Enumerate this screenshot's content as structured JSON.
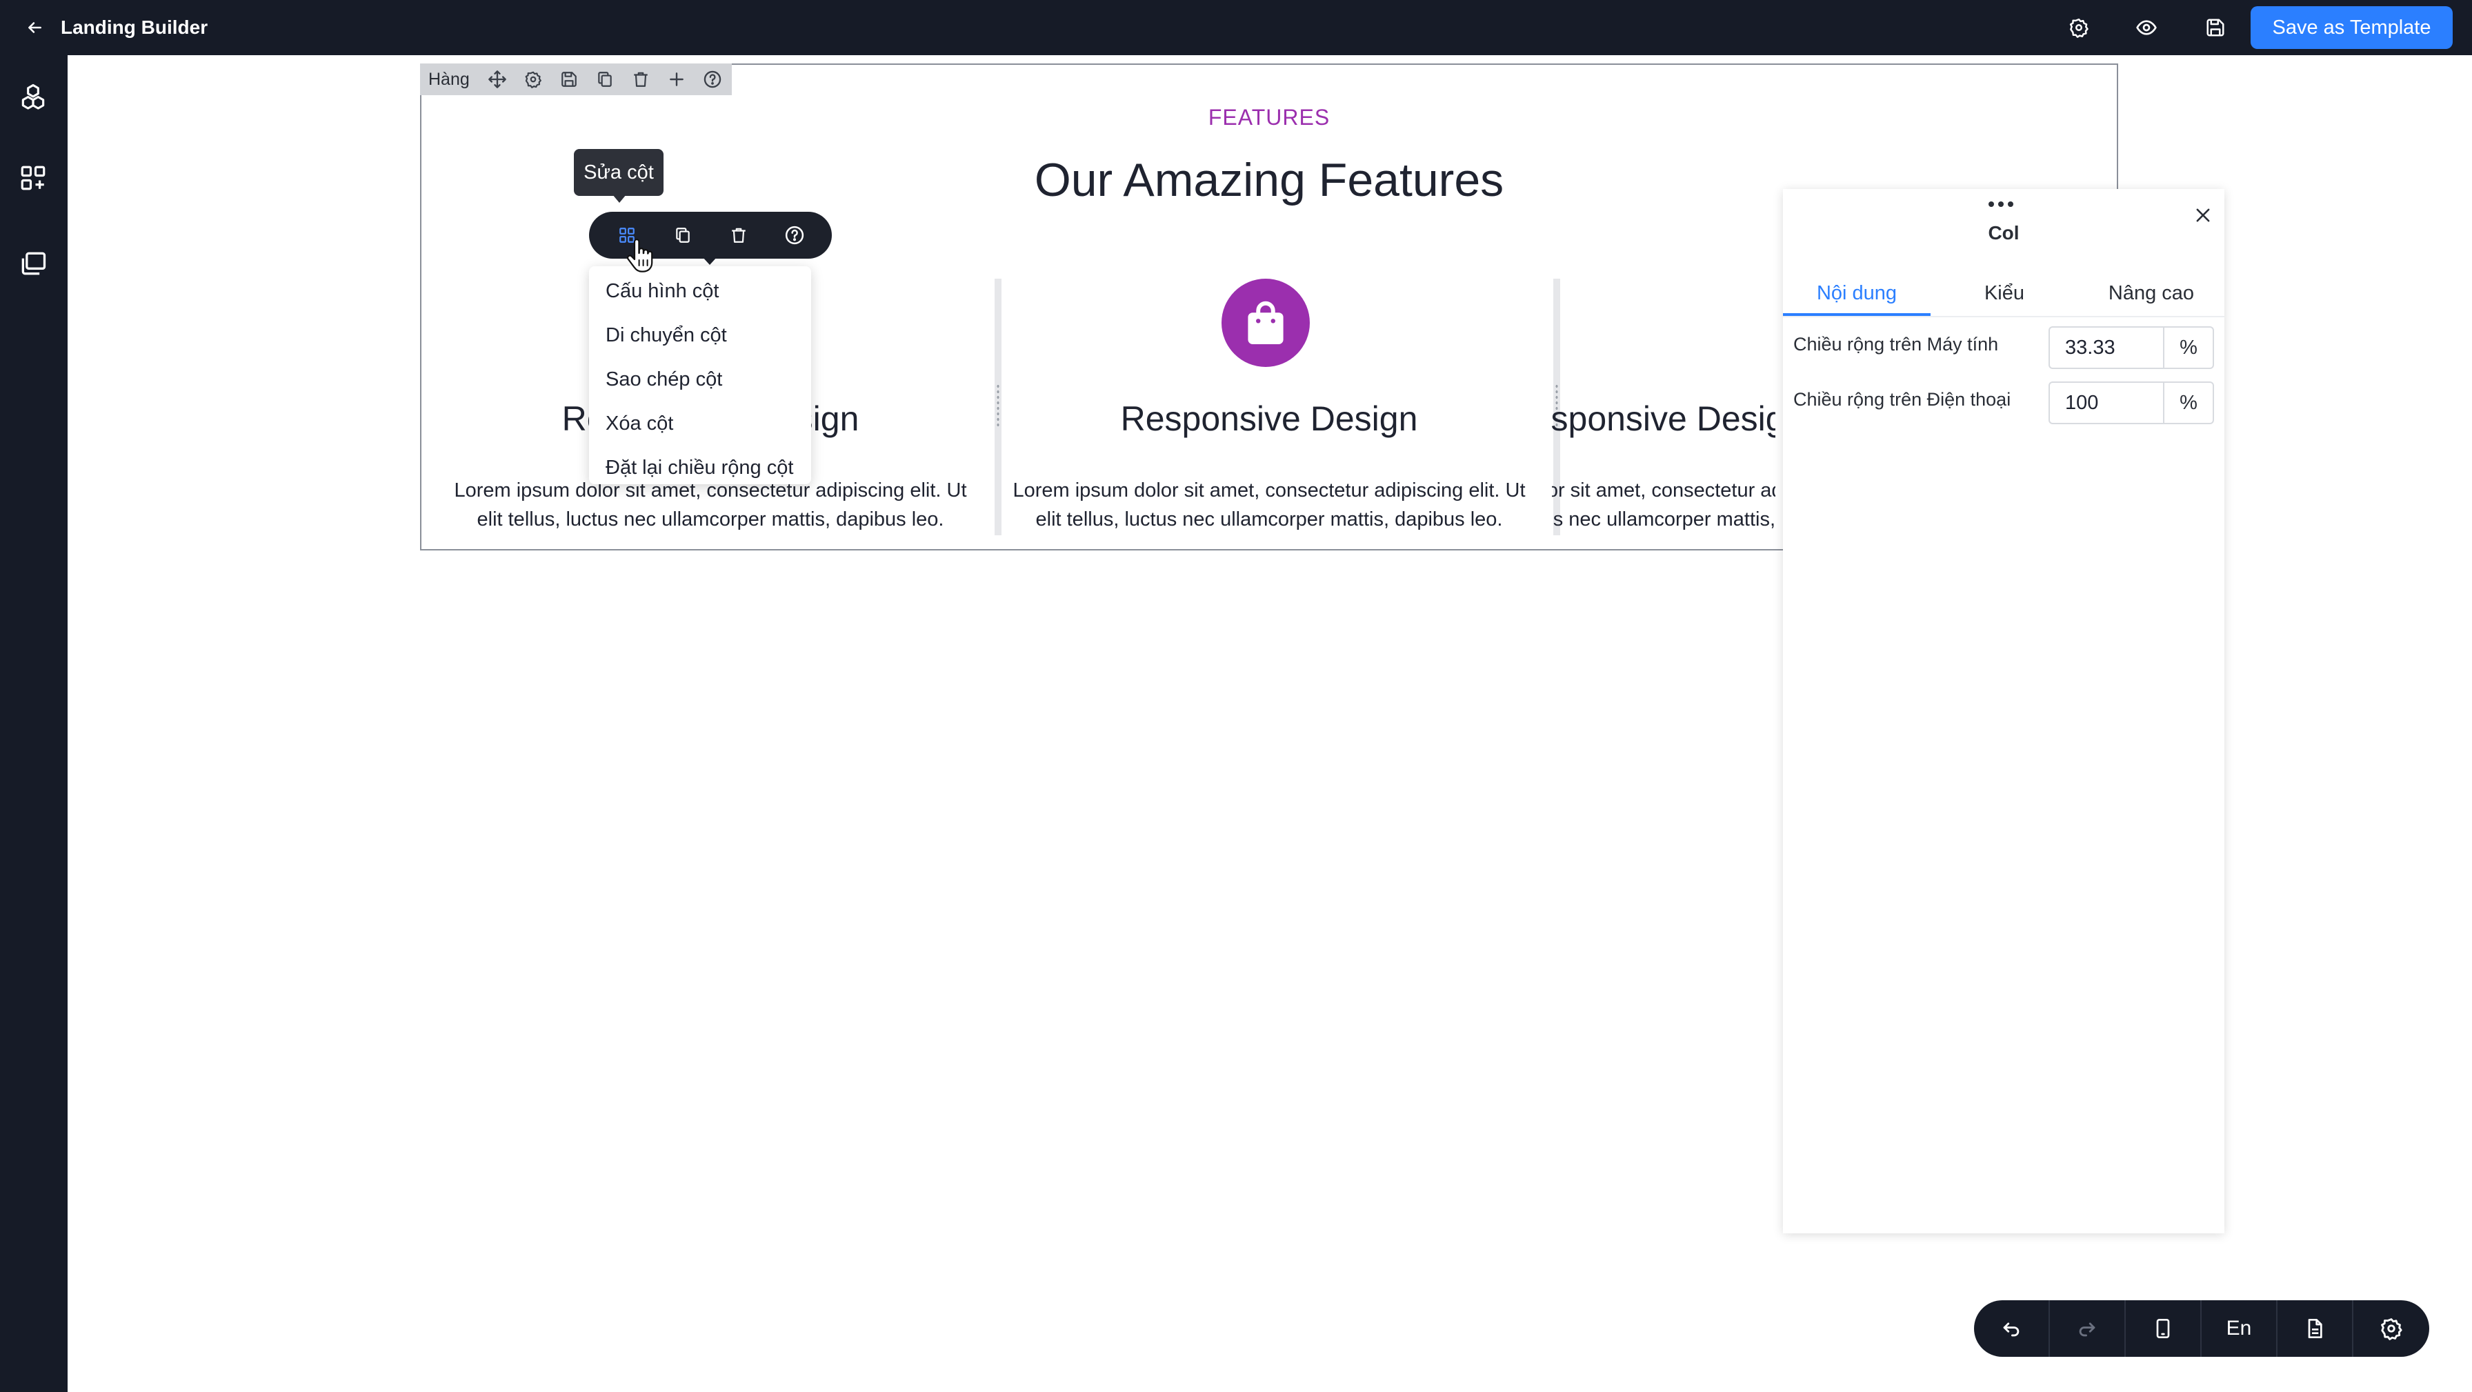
{
  "app": {
    "title": "Landing Builder",
    "save_template_label": "Save as Template"
  },
  "topbar_icons": [
    "settings-icon",
    "eye-icon",
    "save-icon"
  ],
  "sidebar_icons": [
    "cubes-icon",
    "widgets-icon",
    "pages-icon"
  ],
  "row_toolbar": {
    "label": "Hàng",
    "tools": [
      "move-icon",
      "settings-icon",
      "save-icon",
      "copy-icon",
      "trash-icon",
      "plus-icon",
      "help-icon"
    ]
  },
  "section": {
    "tag": "FEATURES",
    "title": "Our Amazing Features",
    "columns": [
      {
        "title": "Responsive Design",
        "text": "Lorem ipsum dolor sit amet, consectetur adipiscing elit. Ut elit tellus, luctus nec ullamcorper mattis, dapibus leo."
      },
      {
        "title": "Responsive Design",
        "text": "Lorem ipsum dolor sit amet, consectetur adipiscing elit. Ut elit tellus, luctus nec ullamcorper mattis, dapibus leo."
      },
      {
        "title": "Responsive Design",
        "text": "Lorem ipsum dolor sit amet, consectetur adipiscing elit. Ut elit tellus, luctus nec ullamcorper mattis, dapibus leo."
      }
    ]
  },
  "column_toolbar": {
    "tooltip": "Sửa cột",
    "tools": [
      "grid-icon",
      "copy-icon",
      "trash-icon",
      "help-icon"
    ]
  },
  "column_menu": [
    "Cấu hình cột",
    "Di chuyển cột",
    "Sao chép cột",
    "Xóa cột",
    "Đặt lại chiều rộng cột"
  ],
  "panel": {
    "title": "Col",
    "tabs": [
      "Nội dung",
      "Kiểu",
      "Nâng cao"
    ],
    "active_tab": "Nội dung",
    "fields": [
      {
        "label": "Chiều rộng trên Máy tính",
        "value": "33.33",
        "unit": "%"
      },
      {
        "label": "Chiều rộng trên Điện thoại",
        "value": "100",
        "unit": "%"
      }
    ]
  },
  "bottom_toolbar": {
    "language": "En",
    "icons": [
      "undo-icon",
      "redo-icon",
      "mobile-icon",
      "language",
      "document-icon",
      "settings-icon"
    ]
  },
  "colors": {
    "accent": "#2b7fff",
    "brand": "#9b2fae",
    "dark": "#161b27"
  }
}
